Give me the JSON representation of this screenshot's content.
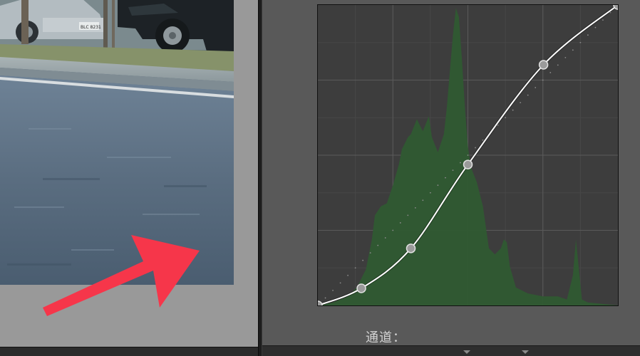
{
  "photo": {
    "plate_text": "BLC 8231"
  },
  "tone_curve": {
    "channel_label": "通道：",
    "grid_divisions": 4,
    "curve_color": "#ffffff",
    "histogram_color": "#2f5a31",
    "point_color": "#9a9a9a",
    "points": [
      {
        "input": 0.0,
        "output": 0.0
      },
      {
        "input": 0.145,
        "output": 0.057
      },
      {
        "input": 0.31,
        "output": 0.19
      },
      {
        "input": 0.5,
        "output": 0.469
      },
      {
        "input": 0.752,
        "output": 0.801
      },
      {
        "input": 1.0,
        "output": 1.0
      }
    ]
  },
  "annotation": {
    "arrow_color": "#f6364a"
  }
}
